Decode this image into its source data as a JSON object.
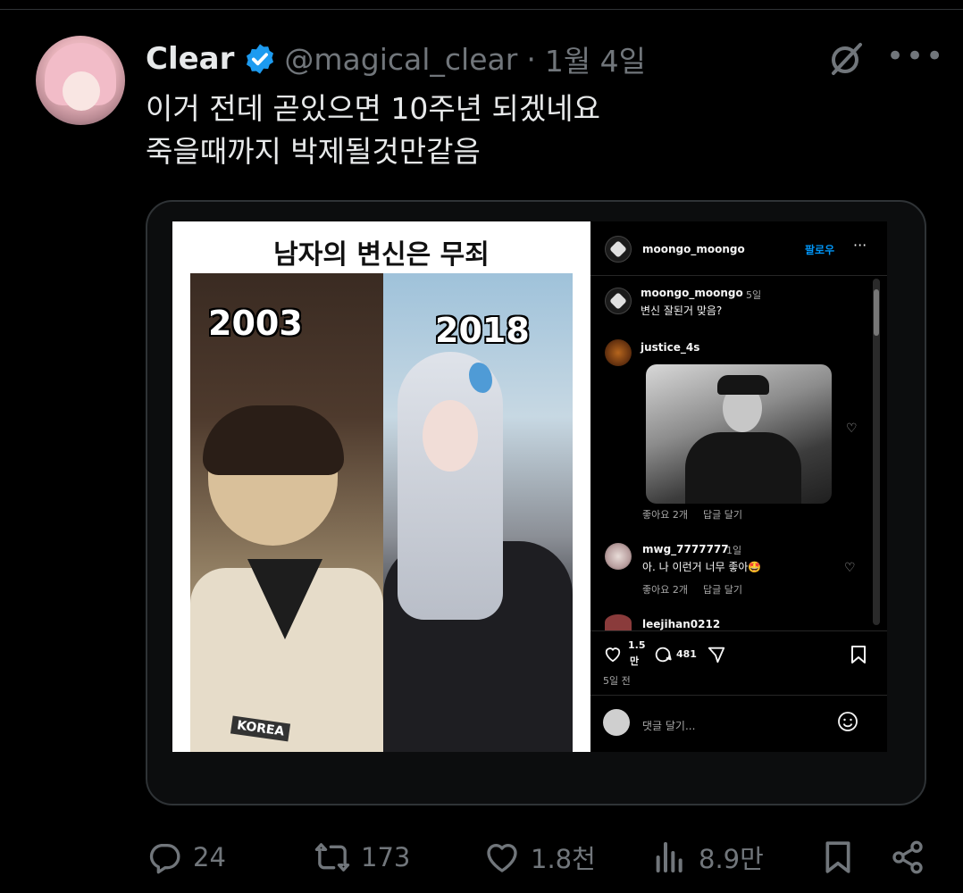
{
  "tweet": {
    "author_name": "Clear",
    "handle": "@magical_clear",
    "separator": "·",
    "date": "1월 4일",
    "text_line1": "이거 전데 곧있으면 10주년 되겠네요",
    "text_line2": "죽을때까지 박제될것만같음",
    "verified_color": "#1d9bf0"
  },
  "meme": {
    "title": "남자의 변신은 무죄",
    "year_left": "2003",
    "year_right": "2018",
    "badge": "KOREA"
  },
  "instagram": {
    "post_user": "moongo_moongo",
    "follow_label": "팔로우",
    "more_label": "···",
    "caption_user": "moongo_moongo",
    "caption_time": "5일",
    "caption_text": "변신 잘된거 맞음?",
    "comment1_user": "justice_4s",
    "comment1_likes": "좋아요 2개",
    "comment1_reply": "답글 달기",
    "comment2_user": "mwg_7777777",
    "comment2_time": "1일",
    "comment2_text": "아. 나 이런거 너무 좋아🤩",
    "comment2_likes": "좋아요 2개",
    "comment2_reply": "답글 달기",
    "comment3_user": "leejihan0212",
    "like_count_top": "1.5",
    "like_count_bottom": "만",
    "comment_count": "481",
    "post_age": "5일 전",
    "comment_placeholder": "댓글 달기..."
  },
  "actions": {
    "replies": "24",
    "reposts": "173",
    "likes": "1.8천",
    "views": "8.9만"
  },
  "icons": [
    "verified-badge-icon",
    "grok-icon",
    "more-icon",
    "reply-icon",
    "repost-icon",
    "like-icon",
    "views-icon",
    "bookmark-icon",
    "share-icon"
  ]
}
